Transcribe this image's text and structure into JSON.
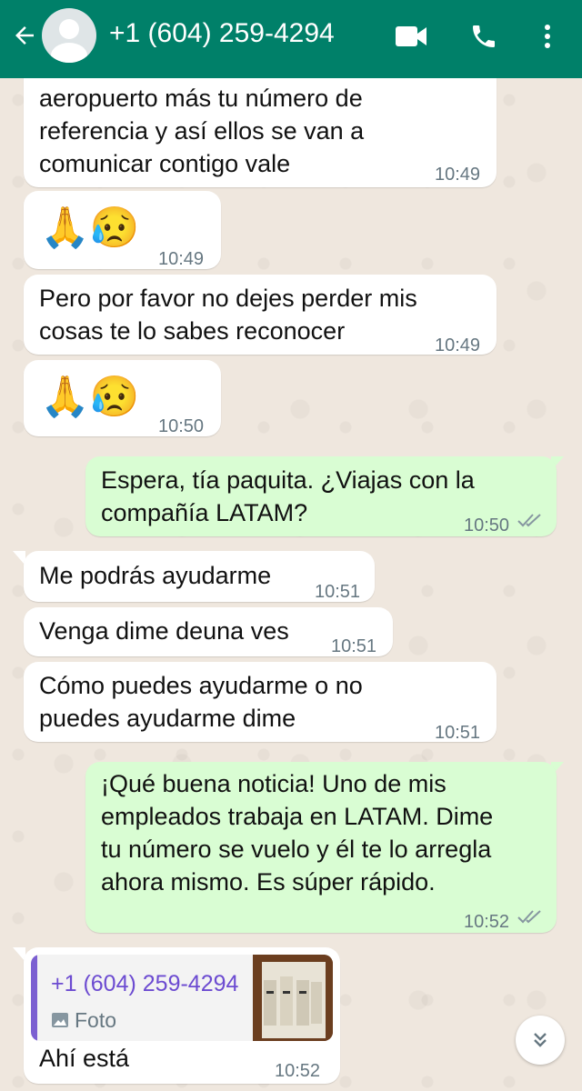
{
  "header": {
    "contact": "+1 (604) 259-4294",
    "color": "#008069"
  },
  "messages": [
    {
      "dir": "in",
      "lines": [
        "aeropuerto más tu número de",
        "referencia y así ellos se van a",
        "comunicar contigo vale"
      ],
      "time": "10:49"
    },
    {
      "dir": "in",
      "emoji": "🙏😥",
      "time": "10:49"
    },
    {
      "dir": "in",
      "lines": [
        "Pero por favor no dejes perder mis",
        "cosas te lo sabes reconocer"
      ],
      "time": "10:49"
    },
    {
      "dir": "in",
      "emoji": "🙏😥",
      "time": "10:50"
    },
    {
      "dir": "out",
      "lines": [
        "Espera, tía paquita. ¿Viajas con la",
        "compañía LATAM?"
      ],
      "time": "10:50",
      "status": "read"
    },
    {
      "dir": "in",
      "lines": [
        "Me podrás ayudarme"
      ],
      "time": "10:51"
    },
    {
      "dir": "in",
      "lines": [
        "Venga dime deuna ves"
      ],
      "time": "10:51"
    },
    {
      "dir": "in",
      "lines": [
        "Cómo puedes ayudarme o no",
        "puedes ayudarme dime"
      ],
      "time": "10:51"
    },
    {
      "dir": "out",
      "lines": [
        "¡Qué buena noticia! Uno de mis",
        "empleados trabaja en LATAM. Dime",
        "tu número se vuelo y él te lo arregla",
        "ahora mismo. Es súper rápido."
      ],
      "time": "10:52",
      "status": "read"
    },
    {
      "dir": "in",
      "quote": {
        "name": "+1 (604) 259-4294",
        "type": "Foto"
      },
      "lines": [
        "Ahí está"
      ],
      "time": "10:52"
    }
  ],
  "icons": [
    "back-arrow-icon",
    "avatar",
    "video-call-icon",
    "phone-icon",
    "more-options-icon",
    "double-check-icon",
    "photo-icon",
    "scroll-down-icon"
  ],
  "colors": {
    "incoming": "#ffffff",
    "outgoing": "#d9fdd3",
    "background": "#efe7de",
    "quote_accent": "#7b5fd1"
  }
}
